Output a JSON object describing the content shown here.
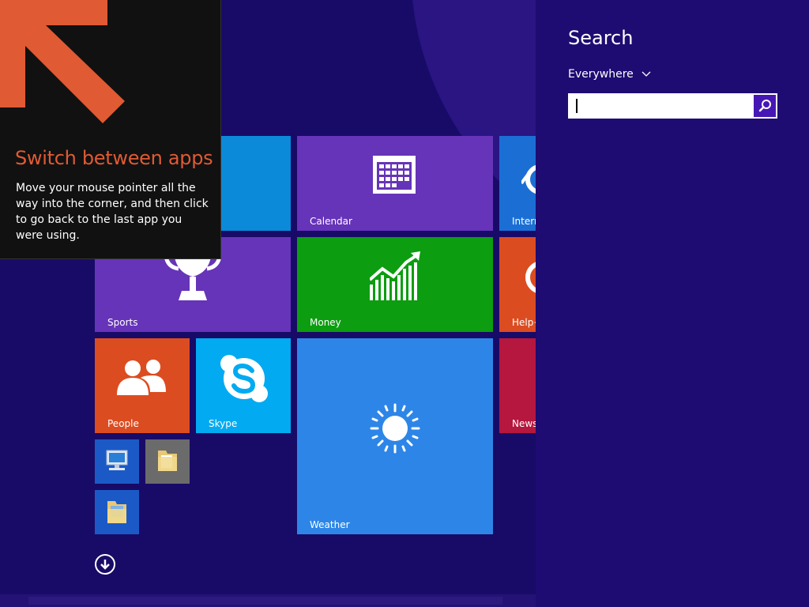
{
  "start_screen": {
    "tiles": [
      {
        "id": "calendar",
        "label": "Calendar",
        "color": "#6634b8"
      },
      {
        "id": "internet",
        "label": "Intern",
        "color": "#1b6fd4"
      },
      {
        "id": "sports",
        "label": "Sports",
        "color": "#6634b8"
      },
      {
        "id": "money",
        "label": "Money",
        "color": "#0c9d10"
      },
      {
        "id": "help",
        "label": "Help+",
        "color": "#dc4c21"
      },
      {
        "id": "people",
        "label": "People",
        "color": "#dc4c21"
      },
      {
        "id": "skype",
        "label": "Skype",
        "color": "#01aaf1"
      },
      {
        "id": "weather",
        "label": "Weather",
        "color": "#2d86e7"
      },
      {
        "id": "news",
        "label": "News",
        "color": "#b5173e"
      },
      {
        "id": "top-blue",
        "label": "",
        "color": "#0a8ad8"
      },
      {
        "id": "desktop",
        "label": "",
        "color": "#1b5ac6",
        "icon": "computer-icon"
      },
      {
        "id": "folder",
        "label": "",
        "color": "#6b6b6b",
        "icon": "folder-icon"
      },
      {
        "id": "explorer",
        "label": "",
        "color": "#1b5ac6",
        "icon": "file-explorer-icon"
      }
    ],
    "all_apps_icon": "down-arrow-icon"
  },
  "tip": {
    "title": "Switch between apps",
    "body": "Move your mouse pointer all the way into the corner, and then click to go back to the last app you were using.",
    "title_color": "#e05a33",
    "arrow_color": "#e05a33"
  },
  "search_charm": {
    "title": "Search",
    "scope": "Everywhere",
    "query": "",
    "accent": "#4617b4",
    "icon": "search-icon"
  }
}
